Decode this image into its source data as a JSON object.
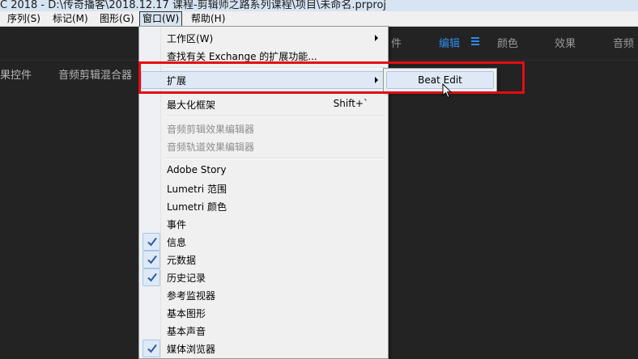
{
  "window": {
    "title": "C 2018 - D:\\传奇播客\\2018.12.17 课程-剪辑师之路系列课程\\项目\\未命名.prproj"
  },
  "menubar": {
    "items": [
      {
        "label": "序列(S)"
      },
      {
        "label": "标记(M)"
      },
      {
        "label": "图形(G)"
      },
      {
        "label": "窗口(W)"
      },
      {
        "label": "帮助(H)"
      }
    ]
  },
  "workspaces": {
    "items": [
      {
        "label": "件"
      },
      {
        "label": "编辑"
      },
      {
        "label": "颜色"
      },
      {
        "label": "效果"
      },
      {
        "label": "音频"
      }
    ],
    "active": "编辑",
    "accent_color": "#2d8ceb"
  },
  "panels": {
    "tabs": [
      {
        "label": "果控件"
      },
      {
        "label": "音频剪辑混合器"
      }
    ]
  },
  "window_menu": {
    "workspace": {
      "label": "工作区(W)"
    },
    "exchange": {
      "label": "查找有关 Exchange 的扩展功能..."
    },
    "extensions": {
      "label": "扩展"
    },
    "maximize_frame": {
      "label": "最大化框架",
      "shortcut": "Shift+`"
    },
    "audio_clip_effect_editor": {
      "label": "音频剪辑效果编辑器"
    },
    "audio_track_effect_editor": {
      "label": "音频轨道效果编辑器"
    },
    "adobe_story": {
      "label": "Adobe Story"
    },
    "lumetri_scopes": {
      "label": "Lumetri 范围"
    },
    "lumetri_color": {
      "label": "Lumetri 颜色"
    },
    "events": {
      "label": "事件"
    },
    "info": {
      "label": "信息",
      "checked": true
    },
    "metadata": {
      "label": "元数据",
      "checked": true
    },
    "history": {
      "label": "历史记录",
      "checked": true
    },
    "reference_monitor": {
      "label": "参考监视器"
    },
    "essential_graphics": {
      "label": "基本图形"
    },
    "essential_sound": {
      "label": "基本声音"
    },
    "media_browser": {
      "label": "媒体浏览器",
      "checked": true
    }
  },
  "extensions_submenu": {
    "items": [
      {
        "label": "Beat Edit"
      }
    ]
  },
  "annotation": {
    "color": "#e30d10"
  }
}
